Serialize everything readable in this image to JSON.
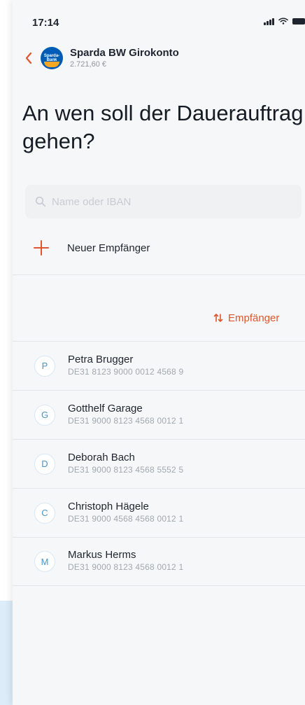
{
  "status_bar": {
    "time": "17:14",
    "icons": [
      "signal-icon",
      "wifi-icon",
      "battery-icon"
    ]
  },
  "header": {
    "back_icon": "chevron-left-icon",
    "logo_text": "Sparda-Bank",
    "account_name": "Sparda BW Girokonto",
    "account_balance": "2.721,60 €"
  },
  "page": {
    "title": "An wen soll der Dauerauftrag gehen?"
  },
  "search": {
    "icon": "search-icon",
    "placeholder": "Name oder IBAN"
  },
  "new_recipient": {
    "icon": "plus-icon",
    "label": "Neuer Empfänger"
  },
  "sort": {
    "icon": "sort-icon",
    "label": "Empfänger"
  },
  "recipients": [
    {
      "initial": "P",
      "name": "Petra Brugger",
      "iban": "DE31 8123 9000 0012 4568 9"
    },
    {
      "initial": "G",
      "name": "Gotthelf Garage",
      "iban": "DE31 9000 8123 4568 0012 1"
    },
    {
      "initial": "D",
      "name": "Deborah Bach",
      "iban": "DE31 9000 8123 4568 5552 5"
    },
    {
      "initial": "C",
      "name": "Christoph Hägele",
      "iban": "DE31 9000 4568 4568 0012 1"
    },
    {
      "initial": "M",
      "name": "Markus Herms",
      "iban": "DE31 9000 8123 4568 0012 1"
    }
  ],
  "colors": {
    "accent": "#e0552d",
    "avatar_text": "#4a94c8",
    "bank_blue": "#005bb5",
    "background": "#f6f7f8"
  }
}
